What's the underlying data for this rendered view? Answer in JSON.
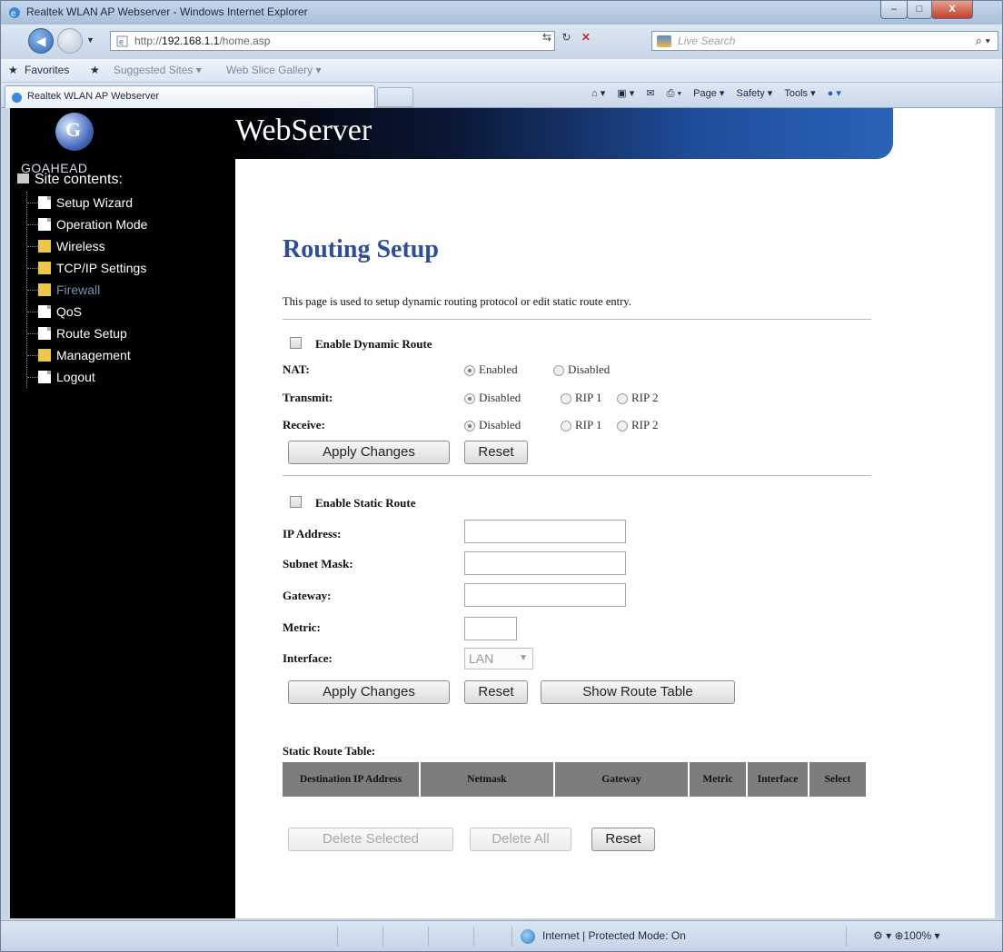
{
  "window": {
    "title": "Realtek WLAN AP Webserver - Windows Internet Explorer",
    "minimize": "–",
    "maximize": "□",
    "close": "X"
  },
  "address_bar": {
    "url_prefix": "http://",
    "url_host": "192.168.1.1",
    "url_path": "/home.asp",
    "search_placeholder": "Live Search",
    "refresh_icon": "↻",
    "stop_icon": "✕",
    "compat_icon": "⇆"
  },
  "favorites_bar": {
    "favorites": "Favorites",
    "suggested_sites": "Suggested Sites ▾",
    "web_slice_gallery": "Web Slice Gallery ▾"
  },
  "tab": {
    "title": "Realtek WLAN AP Webserver"
  },
  "command_bar": {
    "home": "⌂ ▾",
    "feeds": "▣ ▾",
    "mail": "✉",
    "print": "⎙ ▾",
    "page": "Page ▾",
    "safety": "Safety ▾",
    "tools": "Tools ▾",
    "help": "● ▾"
  },
  "header": {
    "logo_text": "GOAHEAD",
    "banner_text": "WebServer"
  },
  "sidebar": {
    "heading": "Site contents:",
    "items": [
      {
        "label": "Setup Wizard",
        "type": "doc"
      },
      {
        "label": "Operation Mode",
        "type": "doc"
      },
      {
        "label": "Wireless",
        "type": "folder"
      },
      {
        "label": "TCP/IP Settings",
        "type": "folder"
      },
      {
        "label": "Firewall",
        "type": "folder"
      },
      {
        "label": "QoS",
        "type": "doc"
      },
      {
        "label": "Route Setup",
        "type": "doc"
      },
      {
        "label": "Management",
        "type": "folder"
      },
      {
        "label": "Logout",
        "type": "doc"
      }
    ]
  },
  "page": {
    "title": "Routing Setup",
    "description": "This page is used to setup dynamic routing protocol or edit static route entry.",
    "dynamic": {
      "enable_label": "Enable Dynamic Route",
      "nat_label": "NAT:",
      "nat_options": [
        "Enabled",
        "Disabled"
      ],
      "nat_selected": "Enabled",
      "transmit_label": "Transmit:",
      "transmit_options": [
        "Disabled",
        "RIP 1",
        "RIP 2"
      ],
      "transmit_selected": "Disabled",
      "receive_label": "Receive:",
      "receive_options": [
        "Disabled",
        "RIP 1",
        "RIP 2"
      ],
      "receive_selected": "Disabled",
      "apply_button": "Apply Changes",
      "reset_button": "Reset"
    },
    "static": {
      "enable_label": "Enable Static Route",
      "ip_label": "IP Address:",
      "ip_value": "",
      "mask_label": "Subnet Mask:",
      "mask_value": "",
      "gateway_label": "Gateway:",
      "gateway_value": "",
      "metric_label": "Metric:",
      "metric_value": "",
      "interface_label": "Interface:",
      "interface_value": "LAN",
      "apply_button": "Apply Changes",
      "reset_button": "Reset",
      "show_table_button": "Show Route Table"
    },
    "route_table": {
      "title": "Static Route Table:",
      "columns": [
        "Destination IP Address",
        "Netmask",
        "Gateway",
        "Metric",
        "Interface",
        "Select"
      ],
      "delete_selected_button": "Delete Selected",
      "delete_all_button": "Delete All",
      "reset_button": "Reset"
    }
  },
  "status_bar": {
    "zone": "Internet | Protected Mode: On",
    "zoom": "⚙ ▾   ⊕100%  ▾"
  }
}
